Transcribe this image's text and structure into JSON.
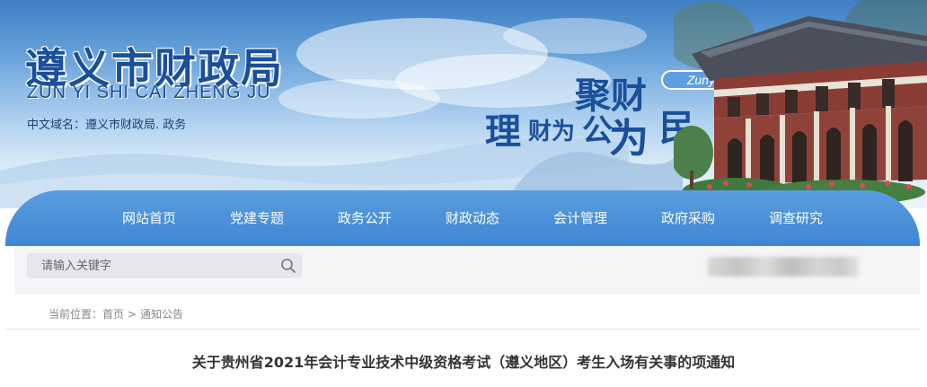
{
  "header": {
    "site_title": "遵义市财政局",
    "site_pinyin": "ZUN YI SHI CAI ZHENG JU",
    "domain_label": "中文域名：遵义市财政局. 政务",
    "slogan": {
      "part1": "聚财",
      "part2": "理",
      "part3": "财为",
      "part4": "公",
      "part5": "为",
      "part6": "民"
    },
    "city_tag": "Zunyi"
  },
  "nav": {
    "items": [
      {
        "label": "网站首页"
      },
      {
        "label": "党建专题"
      },
      {
        "label": "政务公开"
      },
      {
        "label": "财政动态"
      },
      {
        "label": "会计管理"
      },
      {
        "label": "政府采购"
      },
      {
        "label": "调查研究"
      }
    ]
  },
  "search": {
    "placeholder": "请输入关键字",
    "icon": "search-icon"
  },
  "breadcrumb": {
    "prefix": "当前位置：",
    "home": "首页",
    "separator": ">",
    "current": "通知公告"
  },
  "article": {
    "title": "关于贵州省2021年会计专业技术中级资格考试（遵义地区）考生入场有关事的项通知"
  },
  "colors": {
    "brand_blue": "#1a4f9a",
    "nav_blue": "#4a90d9",
    "search_bg": "#f4f5f7",
    "breadcrumb_gray": "#888888"
  }
}
